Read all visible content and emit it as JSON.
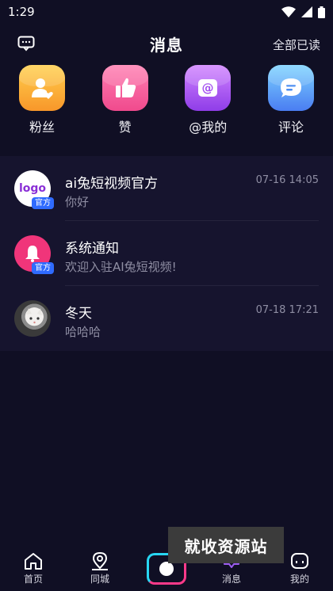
{
  "status_bar": {
    "time": "1:29"
  },
  "header": {
    "title": "消息",
    "mark_all_read": "全部已读"
  },
  "categories": [
    {
      "label": "粉丝",
      "icon": "person-heart-icon"
    },
    {
      "label": "赞",
      "icon": "thumbs-up-icon"
    },
    {
      "label": "@我的",
      "icon": "at-sign-icon"
    },
    {
      "label": "评论",
      "icon": "comment-icon"
    }
  ],
  "messages": [
    {
      "name": "ai兔短视频官方",
      "preview": "你好",
      "time": "07-16 14:05",
      "avatar_text": "logo",
      "badge": "官方"
    },
    {
      "name": "系统通知",
      "preview": "欢迎入驻AI兔短视频!",
      "time": "",
      "avatar": "bell-icon",
      "badge": "官方"
    },
    {
      "name": "冬天",
      "preview": "哈哈哈",
      "time": "07-18 17:21",
      "avatar": "cat-photo"
    }
  ],
  "bottom_nav": {
    "home": "首页",
    "nearby": "同城",
    "messages": "消息",
    "mine": "我的"
  },
  "watermark": "就收资源站",
  "colors": {
    "background": "#100f24",
    "list_background": "#16142e",
    "secondary_text": "#8f8ea3",
    "badge": "#2f6bff"
  }
}
